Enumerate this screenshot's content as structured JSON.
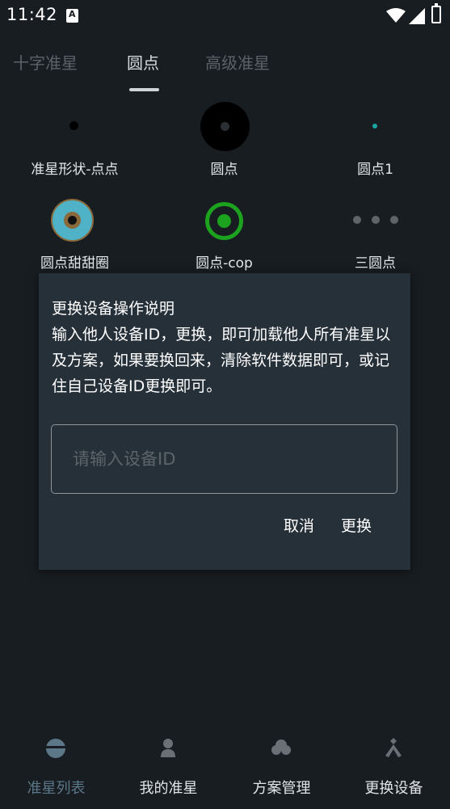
{
  "status_bar": {
    "time": "11:42",
    "icons": [
      "notification-a-icon",
      "wifi-icon",
      "signal-icon",
      "battery-icon"
    ]
  },
  "tabs": [
    {
      "label": "十字准星",
      "active": false
    },
    {
      "label": "圆点",
      "active": true
    },
    {
      "label": "高级准星",
      "active": false
    }
  ],
  "crosshairs": [
    {
      "label": "准星形状-点点",
      "icon": "small-black-dot"
    },
    {
      "label": "圆点",
      "icon": "large-black-circle"
    },
    {
      "label": "圆点1",
      "icon": "small-teal-dot"
    },
    {
      "label": "圆点甜甜圈",
      "icon": "donut"
    },
    {
      "label": "圆点-cop",
      "icon": "green-ring-dot"
    },
    {
      "label": "三圆点",
      "icon": "three-gray-dots"
    }
  ],
  "dialog": {
    "title": "更换设备操作说明",
    "body": "输入他人设备ID，更换，即可加载他人所有准星以及方案，如果要换回来，清除软件数据即可，或记住自己设备ID更换即可。",
    "input_placeholder": "请输入设备ID",
    "input_value": "",
    "cancel_label": "取消",
    "confirm_label": "更换"
  },
  "bottom_nav": [
    {
      "label": "准星列表",
      "icon": "crosshair-list-icon",
      "active": true
    },
    {
      "label": "我的准星",
      "icon": "person-icon",
      "active": false
    },
    {
      "label": "方案管理",
      "icon": "cloud-icon",
      "active": false
    },
    {
      "label": "更换设备",
      "icon": "tools-icon",
      "active": false
    }
  ],
  "colors": {
    "background": "#181d21",
    "dialog": "#263039",
    "active_nav": "#5b7788",
    "teal": "#1aa7a2",
    "green": "#1ca21e"
  }
}
